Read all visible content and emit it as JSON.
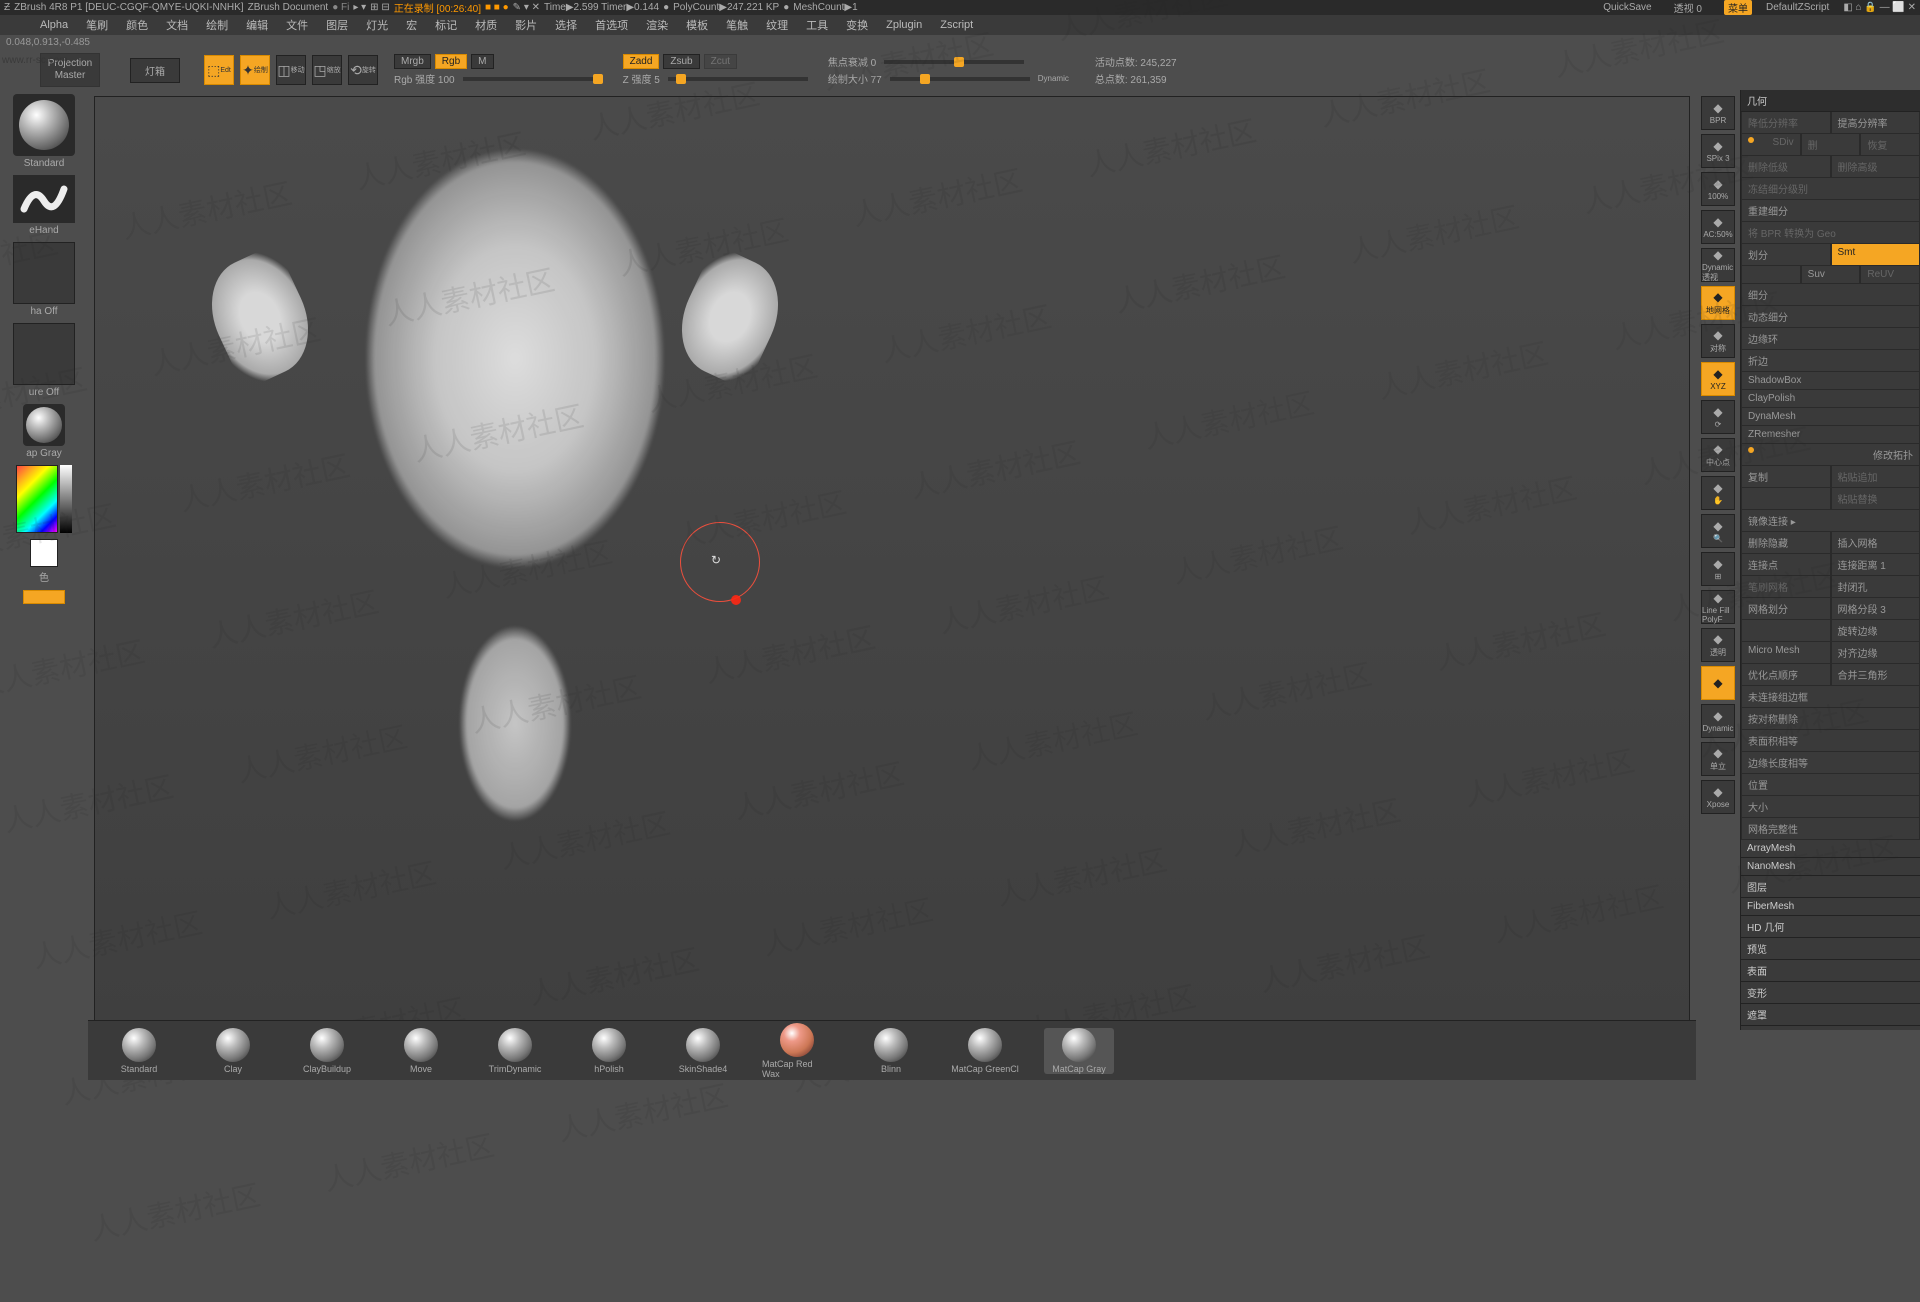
{
  "titlebar": {
    "app": "ZBrush 4R8 P1 [DEUC-CGQF-QMYE-UQKI-NNHK]",
    "doc": "ZBrush Document",
    "recording": "正在录制 [00:26:40]",
    "time": "Time▶2.599 Timer▶0.144",
    "poly": "PolyCount▶247.221 KP",
    "mesh": "MeshCount▶1",
    "quicksave": "QuickSave",
    "transp": "透视 0",
    "menu_btn": "菜单",
    "script": "DefaultZScript"
  },
  "menubar": [
    "Alpha",
    "笔刷",
    "颜色",
    "文档",
    "绘制",
    "编辑",
    "文件",
    "图层",
    "灯光",
    "宏",
    "标记",
    "材质",
    "影片",
    "选择",
    "首选项",
    "渲染",
    "模板",
    "笔触",
    "纹理",
    "工具",
    "变换",
    "Zplugin",
    "Zscript"
  ],
  "status": "0.048,0.913,-0.485",
  "toolbar": {
    "proj": "Projection Master",
    "light": "灯箱",
    "mrgb": "Mrgb",
    "rgb": "Rgb",
    "m": "M",
    "rgb_str": "Rgb 强度 100",
    "zadd": "Zadd",
    "zsub": "Zsub",
    "zcut": "Zcut",
    "z_str": "Z 强度 5",
    "focal": "焦点衰减 0",
    "brush_size": "绘制大小 77",
    "dynamic": "Dynamic",
    "active_pts": "活动点数: 245,227",
    "total_pts": "总点数: 261,359"
  },
  "left": {
    "brush": "Standard",
    "stroke": "eHand",
    "alpha": "ha Off",
    "texture": "ure Off",
    "material": "ap Gray",
    "color": "色"
  },
  "viewtools": [
    {
      "id": "bpr",
      "l": "BPR"
    },
    {
      "id": "spix",
      "l": "SPix 3"
    },
    {
      "id": "scale",
      "l": "100%"
    },
    {
      "id": "aa",
      "l": "AC:50%"
    },
    {
      "id": "persp",
      "l": "Dynamic 透视"
    },
    {
      "id": "floor",
      "l": "地网格",
      "active": true
    },
    {
      "id": "lsym",
      "l": "对称"
    },
    {
      "id": "xyz",
      "l": "XYZ",
      "active": true
    },
    {
      "id": "rot",
      "l": "⟳"
    },
    {
      "id": "center",
      "l": "中心点"
    },
    {
      "id": "hand",
      "l": "✋"
    },
    {
      "id": "zoom",
      "l": "🔍"
    },
    {
      "id": "grid",
      "l": "⊞"
    },
    {
      "id": "line",
      "l": "Line Fill PolyF"
    },
    {
      "id": "transp",
      "l": "透明"
    },
    {
      "id": "solo",
      "l": "",
      "active": true
    },
    {
      "id": "dyn",
      "l": "Dynamic"
    },
    {
      "id": "iso",
      "l": "单立"
    },
    {
      "id": "xpose",
      "l": "Xpose"
    }
  ],
  "right": {
    "head": "几何",
    "rows": [
      [
        {
          "t": "降低分辨率",
          "dim": true
        },
        {
          "t": "提高分辨率"
        }
      ],
      [
        {
          "t": "SDiv",
          "dim": true,
          "orange_dot": true
        },
        {
          "t": "删",
          "dim": true
        },
        {
          "t": "恢复",
          "dim": true
        }
      ],
      [
        {
          "t": "删除低级",
          "dim": true
        },
        {
          "t": "删除高级",
          "dim": true
        }
      ],
      [
        {
          "t": "冻结细分级别",
          "dim": true,
          "full": true
        }
      ],
      [
        {
          "t": "重建细分",
          "full": true
        }
      ],
      [
        {
          "t": "将 BPR 转换为 Geo",
          "dim": true,
          "full": true
        }
      ],
      [
        {
          "t": "划分"
        },
        {
          "t": "Smt",
          "orange": true
        }
      ],
      [
        {
          "t": ""
        },
        {
          "t": "Suv"
        },
        {
          "t": "ReUV",
          "dim": true
        }
      ],
      [
        {
          "t": "细分",
          "full": true
        }
      ],
      [
        {
          "t": "动态细分",
          "full": true
        }
      ],
      [
        {
          "t": "边缘环",
          "full": true
        }
      ],
      [
        {
          "t": "折边",
          "full": true
        }
      ],
      [
        {
          "t": "ShadowBox",
          "full": true
        }
      ],
      [
        {
          "t": "ClayPolish",
          "full": true
        }
      ],
      [
        {
          "t": "DynaMesh",
          "full": true
        }
      ],
      [
        {
          "t": "ZRemesher",
          "full": true
        }
      ],
      [
        {
          "t": "修改拓扑",
          "full": true,
          "orange_dot": true
        }
      ],
      [
        {
          "t": "复制"
        },
        {
          "t": "粘贴追加",
          "dim": true
        }
      ],
      [
        {
          "t": ""
        },
        {
          "t": "粘贴替换",
          "dim": true
        }
      ],
      [
        {
          "t": "镜像连接 ▸",
          "full": true
        }
      ],
      [
        {
          "t": "删除隐藏"
        },
        {
          "t": "插入网格"
        }
      ],
      [
        {
          "t": "连接点"
        },
        {
          "t": "连接距离 1"
        }
      ],
      [
        {
          "t": "笔刷网格",
          "dim": true
        },
        {
          "t": "封闭孔"
        }
      ],
      [
        {
          "t": "网格划分"
        },
        {
          "t": "网格分段 3"
        }
      ],
      [
        {
          "t": ""
        },
        {
          "t": "旋转边缘"
        }
      ],
      [
        {
          "t": "Micro Mesh"
        },
        {
          "t": "对齐边缘"
        }
      ],
      [
        {
          "t": "优化点顺序"
        },
        {
          "t": "合并三角形"
        }
      ],
      [
        {
          "t": "未连接组边框",
          "full": true
        }
      ],
      [
        {
          "t": "按对称删除",
          "full": true
        }
      ],
      [
        {
          "t": "表面积相等",
          "full": true
        }
      ],
      [
        {
          "t": "边缘长度相等",
          "full": true
        }
      ],
      [
        {
          "t": "位置",
          "full": true
        }
      ],
      [
        {
          "t": "大小",
          "full": true
        }
      ],
      [
        {
          "t": "网格完整性",
          "full": true
        }
      ]
    ],
    "sections": [
      "ArrayMesh",
      "NanoMesh",
      "图层",
      "FiberMesh",
      "HD 几何",
      "预览",
      "表面",
      "变形",
      "遮罩"
    ]
  },
  "materials": [
    {
      "n": "Standard",
      "active": true
    },
    {
      "n": "Clay"
    },
    {
      "n": "ClayBuildup"
    },
    {
      "n": "Move"
    },
    {
      "n": "TrimDynamic"
    },
    {
      "n": "hPolish"
    },
    {
      "n": "SkinShade4"
    },
    {
      "n": "MatCap Red Wax",
      "red": true
    },
    {
      "n": "Blinn"
    },
    {
      "n": "MatCap GreenCl"
    },
    {
      "n": "MatCap Gray",
      "sel": true
    }
  ],
  "watermark": "人人素材社区",
  "srcurl": "www.rr-sc.com"
}
